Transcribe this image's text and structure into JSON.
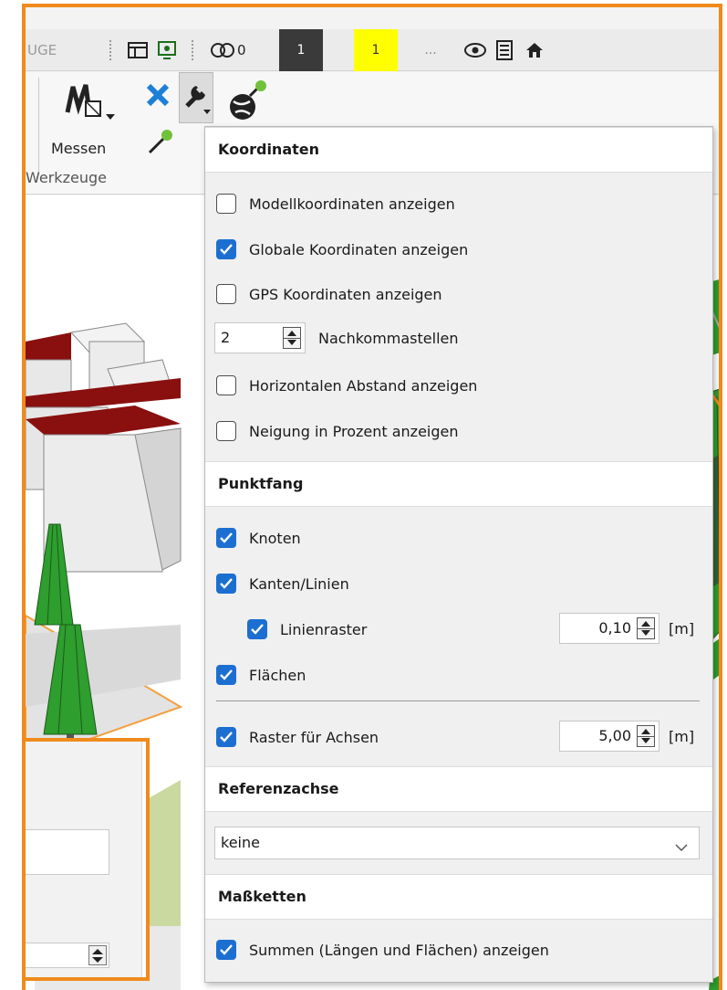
{
  "toolbar": {
    "left_text": "UGE",
    "link_count": "0",
    "page_a": "1",
    "page_b": "1",
    "more": "..."
  },
  "ribbon": {
    "measure_label": "Messen",
    "group_label": "Werkzeuge"
  },
  "panel": {
    "sections": {
      "coordinates": "Koordinaten",
      "snap": "Punktfang",
      "reference_axis": "Referenzachse",
      "dimension_chains": "Maßketten"
    },
    "coordinates": {
      "model_coords": {
        "label": "Modellkoordinaten anzeigen",
        "checked": false
      },
      "global_coords": {
        "label": "Globale Koordinaten anzeigen",
        "checked": true
      },
      "gps_coords": {
        "label": "GPS Koordinaten anzeigen",
        "checked": false
      },
      "decimals": {
        "value": "2",
        "label": "Nachkommastellen"
      },
      "horizontal_distance": {
        "label": "Horizontalen Abstand anzeigen",
        "checked": false
      },
      "slope_percent": {
        "label": "Neigung in Prozent anzeigen",
        "checked": false
      }
    },
    "snap": {
      "nodes": {
        "label": "Knoten",
        "checked": true
      },
      "edges": {
        "label": "Kanten/Linien",
        "checked": true
      },
      "line_grid": {
        "label": "Linienraster",
        "checked": true,
        "value": "0,10",
        "unit": "[m]"
      },
      "faces": {
        "label": "Flächen",
        "checked": true
      },
      "axis_grid": {
        "label": "Raster für Achsen",
        "checked": true,
        "value": "5,00",
        "unit": "[m]"
      }
    },
    "reference_axis": {
      "selected": "keine"
    },
    "dimension_chains": {
      "sums": {
        "label": "Summen (Längen und Flächen) anzeigen",
        "checked": true
      }
    }
  },
  "colors": {
    "accent_orange": "#f08a1c",
    "checkbox_blue": "#1c6fd1",
    "roof_red": "#8a0f0f",
    "tree_green": "#2e9e2e",
    "highlight_yellow": "#ffff00"
  }
}
